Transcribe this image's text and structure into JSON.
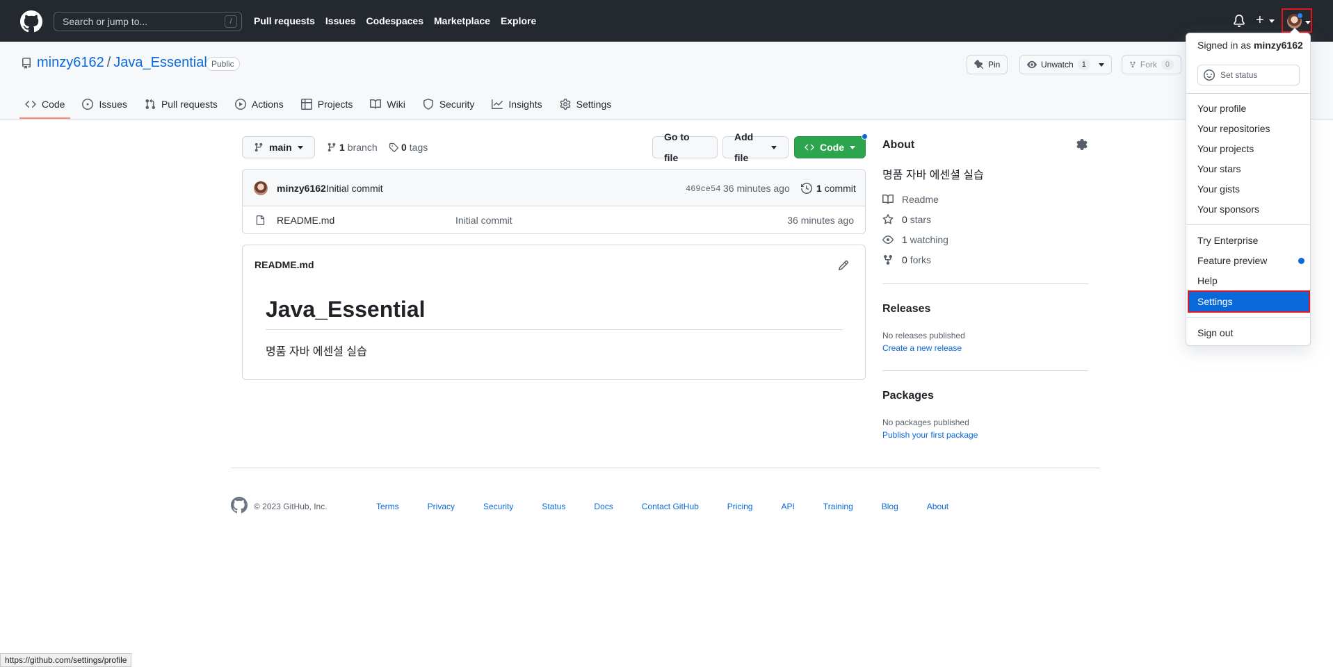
{
  "header": {
    "search_placeholder": "Search or jump to...",
    "search_shortcut": "/",
    "nav": [
      "Pull requests",
      "Issues",
      "Codespaces",
      "Marketplace",
      "Explore"
    ]
  },
  "repo": {
    "owner": "minzy6162",
    "separator": "/",
    "name": "Java_Essential",
    "visibility": "Public",
    "pin_label": "Pin",
    "watch_label": "Unwatch",
    "watch_count": "1",
    "fork_label": "Fork",
    "fork_count": "0",
    "tabs": [
      "Code",
      "Issues",
      "Pull requests",
      "Actions",
      "Projects",
      "Wiki",
      "Security",
      "Insights",
      "Settings"
    ]
  },
  "filenav": {
    "branch": "main",
    "branch_count": "1",
    "branch_label": "branch",
    "tags_count": "0",
    "tags_label": "tags",
    "go_to_file": "Go to file",
    "add_file": "Add file",
    "code": "Code"
  },
  "commit": {
    "author": "minzy6162",
    "message": "Initial commit",
    "sha": "469ce54",
    "time": "36 minutes ago",
    "count": "1",
    "count_label": "commit"
  },
  "files": [
    {
      "name": "README.md",
      "message": "Initial commit",
      "time": "36 minutes ago"
    }
  ],
  "readme": {
    "filename": "README.md",
    "heading": "Java_Essential",
    "body": "명품 자바 에센셜 실습"
  },
  "about": {
    "title": "About",
    "description": "명품 자바 에센셜 실습",
    "readme": "Readme",
    "stars_count": "0",
    "stars_label": "stars",
    "watching_count": "1",
    "watching_label": "watching",
    "forks_count": "0",
    "forks_label": "forks",
    "releases_title": "Releases",
    "releases_empty": "No releases published",
    "releases_link": "Create a new release",
    "packages_title": "Packages",
    "packages_empty": "No packages published",
    "packages_link": "Publish your first package"
  },
  "footer": {
    "copyright": "© 2023 GitHub, Inc.",
    "links": [
      "Terms",
      "Privacy",
      "Security",
      "Status",
      "Docs",
      "Contact GitHub",
      "Pricing",
      "API",
      "Training",
      "Blog",
      "About"
    ]
  },
  "dropdown": {
    "signed_in_prefix": "Signed in as",
    "username": "minzy6162",
    "set_status": "Set status",
    "group1": [
      "Your profile",
      "Your repositories",
      "Your projects",
      "Your stars",
      "Your gists",
      "Your sponsors"
    ],
    "group2": [
      "Try Enterprise",
      "Feature preview",
      "Help"
    ],
    "settings": "Settings",
    "sign_out": "Sign out"
  },
  "statusbar": {
    "url": "https://github.com/settings/profile"
  },
  "colors": {
    "header_bg": "#24292f",
    "accent_blue": "#0969da",
    "code_green": "#2da44e",
    "highlight_red": "#e5131b",
    "tab_underline": "#fd8c73"
  }
}
